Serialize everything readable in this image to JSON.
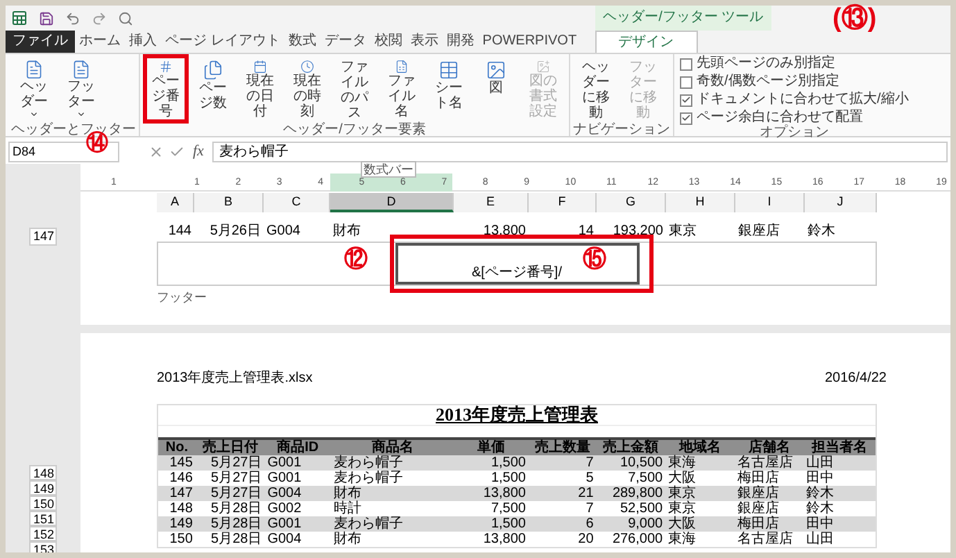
{
  "ribbon": {
    "context_label": "ヘッダー/フッター ツール",
    "tabs": [
      {
        "label": "ファイル",
        "kind": "file",
        "selected": false
      },
      {
        "label": "ホーム",
        "kind": "normal",
        "selected": false
      },
      {
        "label": "挿入",
        "kind": "normal",
        "selected": false
      },
      {
        "label": "ページ レイアウト",
        "kind": "normal",
        "selected": false
      },
      {
        "label": "数式",
        "kind": "normal",
        "selected": false
      },
      {
        "label": "データ",
        "kind": "normal",
        "selected": false
      },
      {
        "label": "校閲",
        "kind": "normal",
        "selected": false
      },
      {
        "label": "表示",
        "kind": "normal",
        "selected": false
      },
      {
        "label": "開発",
        "kind": "normal",
        "selected": false
      },
      {
        "label": "POWERPIVOT",
        "kind": "normal",
        "selected": false
      },
      {
        "label": "デザイン",
        "kind": "context",
        "selected": true
      }
    ],
    "groups": [
      {
        "label": "ヘッダーとフッター",
        "items": [
          {
            "label": "ヘッダー",
            "dropdown": true,
            "disabled": false,
            "highlighted": false
          },
          {
            "label": "フッター",
            "dropdown": true,
            "disabled": false,
            "highlighted": false
          }
        ]
      },
      {
        "label": "ヘッダー/フッター要素",
        "items": [
          {
            "label": "ページ番号",
            "disabled": false,
            "highlighted": true
          },
          {
            "label": "ページ数",
            "disabled": false,
            "highlighted": false
          },
          {
            "label": "現在の日付",
            "disabled": false,
            "highlighted": false
          },
          {
            "label": "現在の時刻",
            "disabled": false,
            "highlighted": false
          },
          {
            "label": "ファイルのパス",
            "disabled": false,
            "highlighted": false
          },
          {
            "label": "ファイル名",
            "disabled": false,
            "highlighted": false
          },
          {
            "label": "シート名",
            "disabled": false,
            "highlighted": false
          },
          {
            "label": "図",
            "disabled": false,
            "highlighted": false
          },
          {
            "label": "図の書式設定",
            "disabled": true,
            "highlighted": false
          }
        ]
      },
      {
        "label": "ナビゲーション",
        "items": [
          {
            "label": "ヘッダーに移動",
            "disabled": false,
            "highlighted": false
          },
          {
            "label": "フッターに移動",
            "disabled": true,
            "highlighted": false
          }
        ]
      }
    ],
    "options": {
      "label": "オプション",
      "checkboxes": [
        {
          "label": "先頭ページのみ別指定",
          "checked": false
        },
        {
          "label": "奇数/偶数ページ別指定",
          "checked": false
        },
        {
          "label": "ドキュメントに合わせて拡大/縮小",
          "checked": true
        },
        {
          "label": "ページ余白に合わせて配置",
          "checked": true
        }
      ]
    }
  },
  "formula_bar": {
    "name_box": "D84",
    "function_label": "fx",
    "value": "麦わら帽子",
    "tooltip": "数式バー"
  },
  "ruler": [
    "1",
    "1",
    "2",
    "3",
    "4",
    "5",
    "6",
    "7",
    "8",
    "9",
    "10",
    "11",
    "12",
    "13",
    "14",
    "15",
    "16",
    "17",
    "18",
    "19"
  ],
  "columns": [
    {
      "label": "A",
      "selected": false
    },
    {
      "label": "B",
      "selected": false
    },
    {
      "label": "C",
      "selected": false
    },
    {
      "label": "D",
      "selected": true
    },
    {
      "label": "E",
      "selected": false
    },
    {
      "label": "F",
      "selected": false
    },
    {
      "label": "G",
      "selected": false
    },
    {
      "label": "H",
      "selected": false
    },
    {
      "label": "I",
      "selected": false
    },
    {
      "label": "J",
      "selected": false
    }
  ],
  "sheet_row": {
    "number": "147",
    "cells": [
      "144",
      "5月26日",
      "G004",
      "財布",
      "13,800",
      "14",
      "193,200",
      "東京",
      "銀座店",
      "鈴木"
    ]
  },
  "footer": {
    "label": "フッター",
    "center_text": "&[ページ番号]/",
    "highlighted": true
  },
  "page": {
    "header_left": "2013年度売上管理表.xlsx",
    "header_right": "2016/4/22",
    "title": "2013年度売上管理表",
    "columns": [
      "No.",
      "売上日付",
      "商品ID",
      "商品名",
      "単価",
      "売上数量",
      "売上金額",
      "地域名",
      "店舗名",
      "担当者名"
    ],
    "rows": [
      {
        "number": "148",
        "shaded": true,
        "cells": [
          "145",
          "5月27日",
          "G001",
          "麦わら帽子",
          "1,500",
          "7",
          "10,500",
          "東海",
          "名古屋店",
          "山田"
        ]
      },
      {
        "number": "149",
        "shaded": false,
        "cells": [
          "146",
          "5月27日",
          "G001",
          "麦わら帽子",
          "1,500",
          "5",
          "7,500",
          "大阪",
          "梅田店",
          "田中"
        ]
      },
      {
        "number": "150",
        "shaded": true,
        "cells": [
          "147",
          "5月27日",
          "G004",
          "財布",
          "13,800",
          "21",
          "289,800",
          "東京",
          "銀座店",
          "鈴木"
        ]
      },
      {
        "number": "151",
        "shaded": false,
        "cells": [
          "148",
          "5月28日",
          "G002",
          "時計",
          "7,500",
          "7",
          "52,500",
          "東京",
          "銀座店",
          "鈴木"
        ]
      },
      {
        "number": "152",
        "shaded": true,
        "cells": [
          "149",
          "5月28日",
          "G001",
          "麦わら帽子",
          "1,500",
          "6",
          "9,000",
          "大阪",
          "梅田店",
          "田中"
        ]
      },
      {
        "number": "153",
        "shaded": false,
        "cells": [
          "150",
          "5月28日",
          "G004",
          "財布",
          "13,800",
          "20",
          "276,000",
          "東海",
          "名古屋店",
          "山田"
        ]
      }
    ]
  },
  "annotations": [
    "⑫",
    "(⑬)",
    "⑭",
    "⑮"
  ]
}
